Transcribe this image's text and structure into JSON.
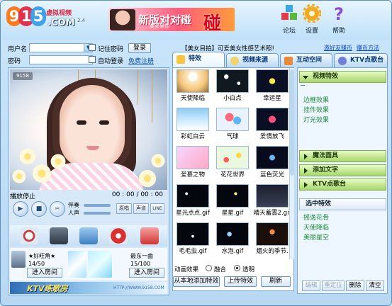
{
  "brand": {
    "logo_digits": "9158",
    "logo_suffix": ".COM",
    "logo_cn": "虚拟视频",
    "version": "2.4"
  },
  "banner": {
    "line1": "新版对对碰",
    "line2": "美女等你",
    "big": "碰"
  },
  "top_buttons": [
    {
      "label": "论坛",
      "icon": "cubes-icon"
    },
    {
      "label": "设置",
      "icon": "gear-icon"
    },
    {
      "label": "帮助",
      "icon": "help-icon"
    }
  ],
  "login": {
    "username_label": "用户名",
    "password_label": "密码",
    "username_value": "",
    "password_value": "",
    "remember_label": "记住密码",
    "auto_label": "自动登录",
    "login_button": "登录",
    "register_link": "免费注册"
  },
  "notice": "【美女目拍】可爱美女性感艺术照!",
  "top_links": [
    "邀好友赚币",
    "赚币方法"
  ],
  "tabs": [
    {
      "label": "特效",
      "active": true
    },
    {
      "label": "视频来源",
      "active": false
    },
    {
      "label": "互动空间",
      "active": false
    },
    {
      "label": "KTV点歌台",
      "active": false
    }
  ],
  "video": {
    "badge": "9158",
    "status": "播放停止",
    "time": "00 : 00 / 00 : 00"
  },
  "controls": {
    "accompaniment": "伴奏",
    "voice": "人声",
    "btn_chorus": "原唱",
    "btn_vol": "声道",
    "btn_line": "LINE"
  },
  "rooms": [
    {
      "name": "★好旺角★",
      "count": "14/50",
      "enter": "进入房间"
    },
    {
      "name": "最东一曲",
      "count": "15/100",
      "enter": "进入房间"
    }
  ],
  "footer": {
    "ktv": "KTV练歌房",
    "url": "HTTP://WWW.9158.COM"
  },
  "effects": [
    {
      "name": "天使降临"
    },
    {
      "name": "小白点"
    },
    {
      "name": "幸运星"
    },
    {
      "name": "彩虹白云"
    },
    {
      "name": "气球"
    },
    {
      "name": "爱情放飞"
    },
    {
      "name": "爱慕之物"
    },
    {
      "name": "花花世界"
    },
    {
      "name": "蓝色荧光"
    },
    {
      "name": "星光点点.gif"
    },
    {
      "name": "星星.gif"
    },
    {
      "name": "晴天蓄雾2.gif"
    },
    {
      "name": "毛毛虫.gif"
    },
    {
      "name": "水泡.gif"
    },
    {
      "name": "烟火的季节."
    }
  ],
  "anim": {
    "label": "动画效果",
    "opt1": "融合",
    "opt2": "透明",
    "selected": "透明"
  },
  "effect_buttons": {
    "add_local": "从本地添加特效",
    "upload": "上传特效",
    "refresh": "刷新"
  },
  "right_panel": {
    "video_effects": "视频特效",
    "items": [
      "边框效果",
      "挂件效果",
      "灯光效果"
    ],
    "magic": "魔法面具",
    "add_text": "添加文字",
    "ktv": "KTV点歌台",
    "selected_header": "选中特效",
    "selected_items": [
      "摇逸花骨",
      "天使降临",
      "美丽星空"
    ],
    "buttons": [
      "编辑",
      "重定位",
      "删除",
      "清空"
    ]
  }
}
